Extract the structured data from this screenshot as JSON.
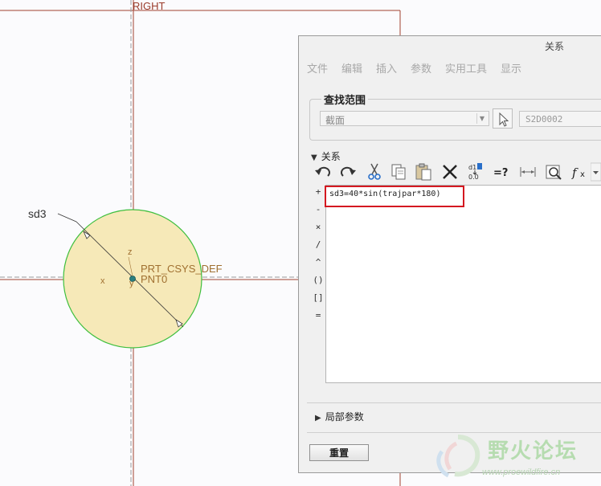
{
  "canvas": {
    "ref_right": "RIGHT",
    "dim_label": "sd3",
    "csys_label": "PRT_CSYS_DEF",
    "pnt_label": "PNT0",
    "axis_z": "z",
    "axis_x": "x",
    "axis_y": "y",
    "circle_fill": "#f6e9b8",
    "circle_stroke": "#3fbf3f",
    "refline_color": "#a04030"
  },
  "dialog": {
    "title": "关系",
    "menu": [
      "文件",
      "编辑",
      "插入",
      "参数",
      "实用工具",
      "显示"
    ],
    "lookin": {
      "title": "查找范围",
      "combo_value": "截面",
      "ref_field_value": "S2D0002"
    },
    "relations_section": "关系",
    "toolbar_icons": [
      "undo-icon",
      "redo-icon",
      "cut-icon",
      "copy-icon",
      "paste-icon",
      "delete-icon",
      "switch-dims-icon",
      "evaluate-icon",
      "measure-icon",
      "verify-icon",
      "function-icon"
    ],
    "operators": [
      "+",
      "-",
      "×",
      "/",
      "^",
      "()",
      "[]",
      "="
    ],
    "relation_text": "sd3=40*sin(trajpar*180)",
    "local_params_section": "局部参数",
    "reset_button": "重置"
  },
  "watermark": {
    "text": "野火论坛",
    "url": "www.proewildfire.cn"
  }
}
